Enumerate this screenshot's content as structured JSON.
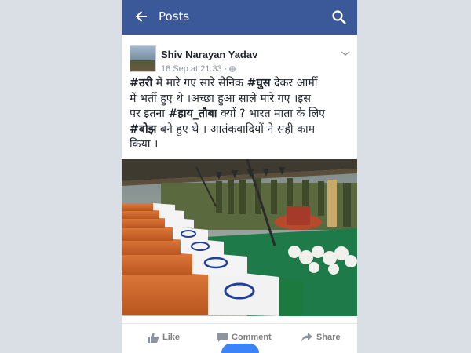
{
  "appbar": {
    "title": "Posts",
    "color": "#3b5998"
  },
  "post": {
    "author": "Shiv Narayan Yadav",
    "timestamp": "18 Sep at 21:33",
    "privacy_icon": "globe-icon",
    "text_lines": [
      [
        "#उरी",
        " में मारे गए सारे सैनिक ",
        "#घुस",
        " देकर आर्मी"
      ],
      [
        "में भर्ती हुए थे ।अच्छा हुआ साले मारे गए ।इस"
      ],
      [
        "पर इतना ",
        "#हाय_तौबा",
        " क्यों ? भारत माता के लिए"
      ],
      [
        "#बोझ",
        " बने हुए थे । आतंकवादियों ने सही काम"
      ],
      [
        "किया ।"
      ]
    ],
    "photo_description_icon": "ceremony-photo"
  },
  "actions": {
    "like": "Like",
    "comment": "Comment",
    "share": "Share"
  }
}
